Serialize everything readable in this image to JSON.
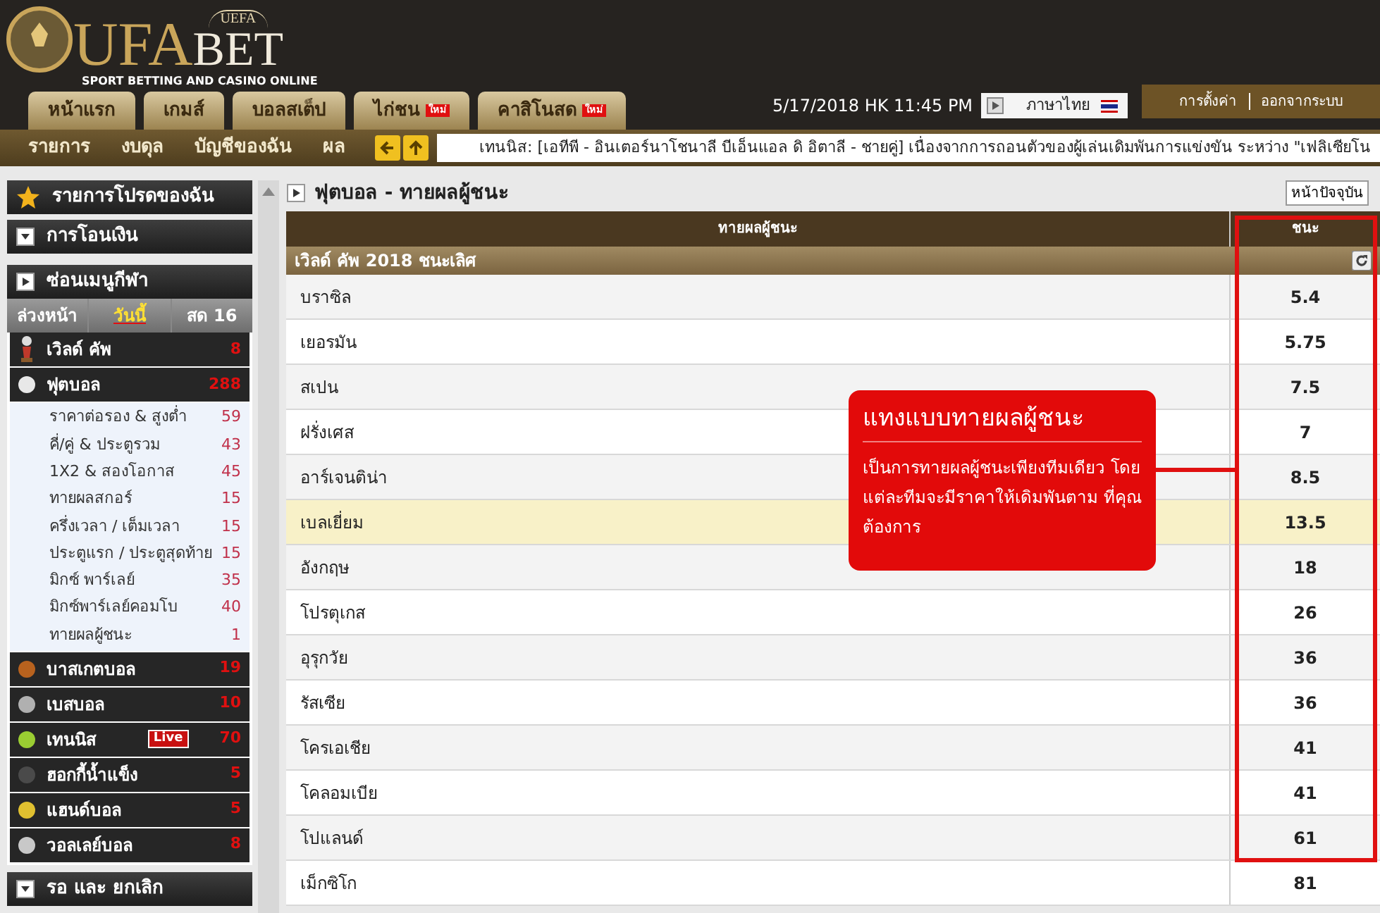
{
  "logo": {
    "crest": "UEFA",
    "brand_left": "UFA",
    "brand_right": "BET",
    "tagline": "SPORT BETTING AND CASINO ONLINE"
  },
  "top_tabs": [
    {
      "label": "หน้าแรก"
    },
    {
      "label": "เกมส์"
    },
    {
      "label": "บอลสเต็ป"
    },
    {
      "label": "ไก่ชน",
      "badge": "ใหม่"
    },
    {
      "label": "คาสิโนสด",
      "badge": "ใหม่"
    }
  ],
  "datetime": "5/17/2018 HK 11:45 PM",
  "language": "ภาษาไทย",
  "account_links": [
    "การตั้งค่า",
    "ออกจากระบบ"
  ],
  "nav_items": [
    "รายการ",
    "งบดุล",
    "บัญชีของฉัน",
    "ผล"
  ],
  "ticker": "เทนนิส: [เอทีพี - อินเตอร์นาโชนาลี บีเอ็นแอล ดิ อิตาลี - ชายคู่] เนื่องจากการถอนตัวของผู้เล่นเดิมพันการแข่งขัน ระหว่าง \"เฟลิเซียโน",
  "sidebar": {
    "favorites": "รายการโปรดของฉัน",
    "transfer": "การโอนเงิน",
    "hide_menu": "ซ่อนเมนูกีฬา",
    "period_tabs": [
      {
        "label": "ล่วงหน้า",
        "selected": false
      },
      {
        "label": "วันนี้",
        "selected": true
      },
      {
        "label": "สด 16",
        "selected": false
      }
    ],
    "sports": [
      {
        "kind": "cup",
        "label": "เวิลด์ คัพ",
        "count": "8",
        "live": false
      },
      {
        "kind": "ball",
        "color": "#e8e8e8",
        "label": "ฟุตบอล",
        "count": "288",
        "live": false,
        "children": [
          {
            "label": "ราคาต่อรอง & สูงต่ำ",
            "count": "59"
          },
          {
            "label": "คี่/คู่ & ประตูรวม",
            "count": "43"
          },
          {
            "label": "1X2 & สองโอกาส",
            "count": "45"
          },
          {
            "label": "ทายผลสกอร์",
            "count": "15"
          },
          {
            "label": "ครึ่งเวลา / เต็มเวลา",
            "count": "15"
          },
          {
            "label": "ประตูแรก / ประตูสุดท้าย",
            "count": "15"
          },
          {
            "label": "มิกซ์ พาร์เลย์",
            "count": "35"
          },
          {
            "label": "มิกซ์พาร์เลย์คอมโบ",
            "count": "40"
          },
          {
            "label": "ทายผลผู้ชนะ",
            "count": "1"
          }
        ]
      },
      {
        "kind": "ball",
        "color": "#b8621e",
        "label": "บาสเกตบอล",
        "count": "19",
        "live": false
      },
      {
        "kind": "ball",
        "color": "#b0b0b0",
        "label": "เบสบอล",
        "count": "10",
        "live": false
      },
      {
        "kind": "ball",
        "color": "#9acd32",
        "label": "เทนนิส",
        "count": "70",
        "live": true,
        "live_label": "Live"
      },
      {
        "kind": "ball",
        "color": "#4a4a4a",
        "label": "ฮอกกี้น้ำแข็ง",
        "count": "5",
        "live": false
      },
      {
        "kind": "ball",
        "color": "#e0c030",
        "label": "แฮนด์บอล",
        "count": "5",
        "live": false
      },
      {
        "kind": "ball",
        "color": "#c8c8c8",
        "label": "วอลเลย์บอล",
        "count": "8",
        "live": false
      }
    ],
    "pending": "รอ และ ยกเลิก"
  },
  "main": {
    "title": "ฟุตบอล - ทายผลผู้ชนะ",
    "current_page_button": "หน้าปัจจุบัน",
    "columns": [
      "ทายผลผู้ชนะ",
      "ชนะ"
    ],
    "group": "เวิลด์ คัพ 2018 ชนะเลิศ",
    "rows": [
      {
        "team": "บราซิล",
        "odds": "5.4",
        "selected": false
      },
      {
        "team": "เยอรมัน",
        "odds": "5.75",
        "selected": false
      },
      {
        "team": "สเปน",
        "odds": "7.5",
        "selected": false
      },
      {
        "team": "ฝรั่งเศส",
        "odds": "7",
        "selected": false
      },
      {
        "team": "อาร์เจนติน่า",
        "odds": "8.5",
        "selected": false
      },
      {
        "team": "เบลเยี่ยม",
        "odds": "13.5",
        "selected": true
      },
      {
        "team": "อังกฤษ",
        "odds": "18",
        "selected": false
      },
      {
        "team": "โปรตุเกส",
        "odds": "26",
        "selected": false
      },
      {
        "team": "อุรุกวัย",
        "odds": "36",
        "selected": false
      },
      {
        "team": "รัสเซีย",
        "odds": "36",
        "selected": false
      },
      {
        "team": "โครเอเชีย",
        "odds": "41",
        "selected": false
      },
      {
        "team": "โคลอมเบีย",
        "odds": "41",
        "selected": false
      },
      {
        "team": "โปแลนด์",
        "odds": "61",
        "selected": false
      },
      {
        "team": "เม็กซิโก",
        "odds": "81",
        "selected": false
      }
    ]
  },
  "callout": {
    "title": "แทงแบบทายผลผู้ชนะ",
    "body": "เป็นการทายผลผู้ชนะเพียงทีมเดียว โดยแต่ละทีมจะมีราคาให้เดิมพันตาม ที่คุณต้องการ"
  }
}
